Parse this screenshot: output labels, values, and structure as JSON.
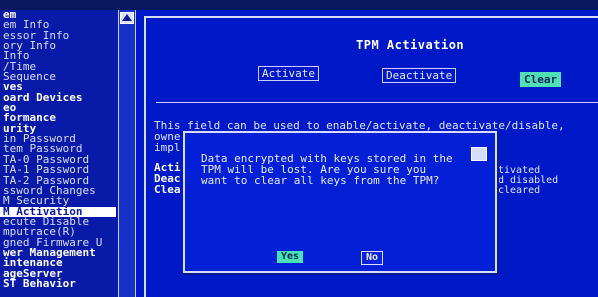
{
  "colors": {
    "bios_blue": "#0019c8",
    "menu_blue": "#0a1aa8",
    "selected_bg": "#ffffff",
    "accent_teal": "#4fe0b6"
  },
  "left_menu": {
    "items": [
      {
        "label": "em",
        "style": "hdr"
      },
      {
        "label": "em Info",
        "style": "norm"
      },
      {
        "label": "essor Info",
        "style": "norm"
      },
      {
        "label": "ory Info",
        "style": "norm"
      },
      {
        "label": "Info",
        "style": "norm"
      },
      {
        "label": "/Time",
        "style": "norm"
      },
      {
        "label": "Sequence",
        "style": "norm"
      },
      {
        "label": "ves",
        "style": "hdr"
      },
      {
        "label": "oard Devices",
        "style": "hdr"
      },
      {
        "label": "eo",
        "style": "hdr"
      },
      {
        "label": "formance",
        "style": "hdr"
      },
      {
        "label": "urity",
        "style": "hdr"
      },
      {
        "label": "in Password",
        "style": "norm"
      },
      {
        "label": "tem Password",
        "style": "norm"
      },
      {
        "label": "TA-0 Password",
        "style": "norm"
      },
      {
        "label": "TA-1 Password",
        "style": "norm"
      },
      {
        "label": "TA-2 Password",
        "style": "norm"
      },
      {
        "label": "ssword Changes",
        "style": "norm"
      },
      {
        "label": "M Security",
        "style": "norm"
      },
      {
        "label": "M Activation",
        "style": "sel"
      },
      {
        "label": "ecute Disable",
        "style": "norm"
      },
      {
        "label": "mputrace(R)",
        "style": "norm"
      },
      {
        "label": "gned Firmware U",
        "style": "norm"
      },
      {
        "label": "wer Management",
        "style": "hdr"
      },
      {
        "label": "intenance",
        "style": "hdr"
      },
      {
        "label": "ageServer",
        "style": "hdr"
      },
      {
        "label": "ST Behavior",
        "style": "hdr"
      }
    ]
  },
  "main": {
    "title": "TPM Activation",
    "options": {
      "activate": "Activate",
      "deactivate": "Deactivate",
      "clear": "Clear"
    },
    "description_lines": [
      "This field can be used to enable/activate, deactivate/disable,",
      "owne",
      "impl                                       . Physical pre"
    ],
    "option_names": [
      "Acti",
      "Deac",
      "Clea"
    ],
    "option_notes": [
      "tivated",
      "d disabled",
      "cleared"
    ]
  },
  "dialog": {
    "lines": [
      "Data encrypted with keys stored in the",
      "TPM will be lost. Are you sure you",
      "want to clear all keys from the TPM?"
    ],
    "yes_label": "Yes",
    "no_label": "No"
  }
}
